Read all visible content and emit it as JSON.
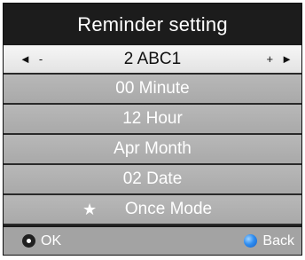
{
  "title": "Reminder setting",
  "rows": {
    "channel": {
      "value": "2 ABC1",
      "left_arrow": "◄",
      "left_sign": "-",
      "right_sign": "+",
      "right_arrow": "►"
    },
    "minute": "00 Minute",
    "hour": "12 Hour",
    "month": "Apr Month",
    "date": "02 Date",
    "mode": {
      "star": "★",
      "label": "Once Mode"
    }
  },
  "footer": {
    "ok_label": "OK",
    "back_label": "Back"
  },
  "icons": {
    "ok": "ok-circle-icon",
    "back": "blue-circle-icon"
  },
  "colors": {
    "title_bg": "#1c1c1c",
    "selected_row": "#f0f0f0",
    "row_bg": "#b0b0b0",
    "back_button": "#2f8df0"
  }
}
